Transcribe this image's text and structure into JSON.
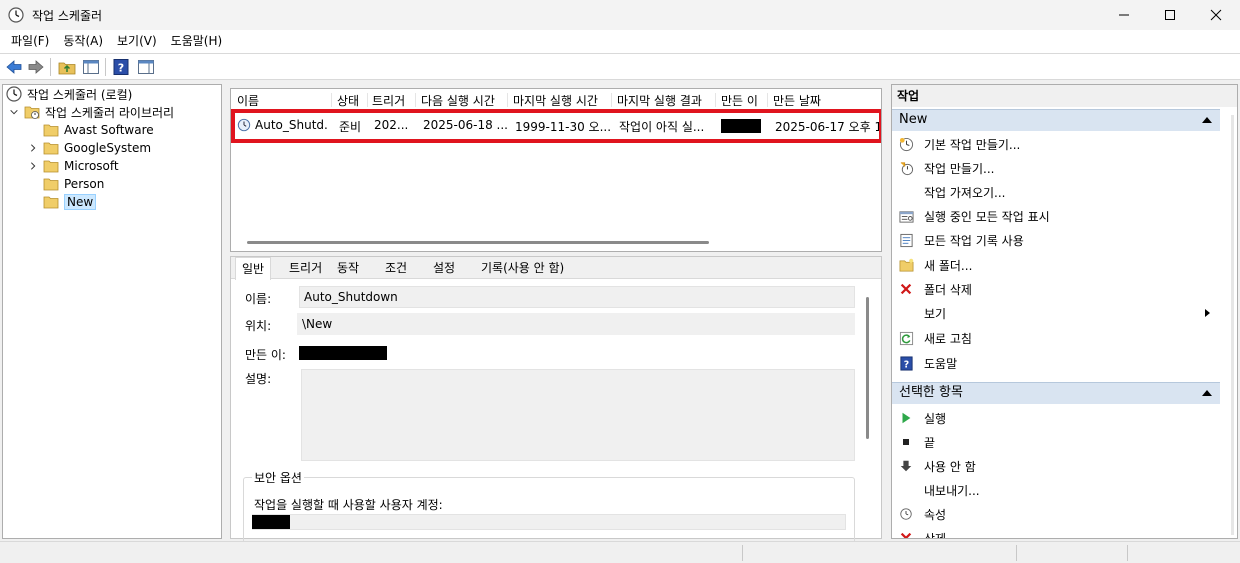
{
  "window": {
    "title": "작업 스케줄러",
    "controls": [
      "minimize",
      "maximize",
      "close"
    ]
  },
  "menu": [
    "파일(F)",
    "동작(A)",
    "보기(V)",
    "도움말(H)"
  ],
  "toolbar": [
    "back-icon",
    "forward-icon",
    "folder-up-icon",
    "show-hide-tree-icon",
    "help-icon",
    "show-hide-action-pane-icon"
  ],
  "tree": {
    "root": "작업 스케줄러 (로컬)",
    "library": "작업 스케줄러 라이브러리",
    "folders": [
      {
        "label": "Avast Software",
        "expandable": false
      },
      {
        "label": "GoogleSystem",
        "expandable": true
      },
      {
        "label": "Microsoft",
        "expandable": true
      },
      {
        "label": "Person",
        "expandable": false
      },
      {
        "label": "New",
        "expandable": false,
        "selected": true
      }
    ]
  },
  "task_list": {
    "columns": [
      "이름",
      "상태",
      "트리거",
      "다음 실행 시간",
      "마지막 실행 시간",
      "마지막 실행 결과",
      "만든 이",
      "만든 날짜"
    ],
    "rows": [
      {
        "name": "Auto_Shutd...",
        "status": "준비",
        "trigger": "202...",
        "next_run": "2025-06-18 ...",
        "last_run": "1999-11-30 오...",
        "last_result": "작업이 아직 실...",
        "author": "",
        "created": "2025-06-17 오후 1"
      }
    ]
  },
  "details": {
    "tabs": [
      "일반",
      "트리거",
      "동작",
      "조건",
      "설정",
      "기록(사용 안 함)"
    ],
    "active_tab": "일반",
    "name_label": "이름:",
    "name_value": "Auto_Shutdown",
    "location_label": "위치:",
    "location_value": "\\New",
    "author_label": "만든 이:",
    "description_label": "설명:",
    "security_group": "보안 옵션",
    "security_account_label": "작업을 실행할 때 사용할 사용자 계정:"
  },
  "actions": {
    "header": "작업",
    "section1": {
      "title": "New",
      "items": [
        {
          "label": "기본 작업 만들기...",
          "icon": "create-basic-task-icon"
        },
        {
          "label": "작업 만들기...",
          "icon": "create-task-icon"
        },
        {
          "label": "작업 가져오기...",
          "icon": ""
        },
        {
          "label": "실행 중인 모든 작업 표시",
          "icon": "running-tasks-icon"
        },
        {
          "label": "모든 작업 기록 사용",
          "icon": "task-history-icon"
        },
        {
          "label": "새 폴더...",
          "icon": "new-folder-icon"
        },
        {
          "label": "폴더 삭제",
          "icon": "delete-x-icon"
        },
        {
          "label": "보기",
          "icon": "",
          "submenu": true
        },
        {
          "label": "새로 고침",
          "icon": "refresh-icon"
        },
        {
          "label": "도움말",
          "icon": "help-icon"
        }
      ]
    },
    "section2": {
      "title": "선택한 항목",
      "items": [
        {
          "label": "실행",
          "icon": "run-icon"
        },
        {
          "label": "끝",
          "icon": "end-icon"
        },
        {
          "label": "사용 안 함",
          "icon": "disable-icon"
        },
        {
          "label": "내보내기...",
          "icon": ""
        },
        {
          "label": "속성",
          "icon": "properties-icon"
        },
        {
          "label": "삭제",
          "icon": "delete-x-icon"
        }
      ]
    }
  },
  "colors": {
    "highlight_box": "#e0141e",
    "section_header_bg": "#d9e4f1",
    "tree_selection": "#cce8ff"
  }
}
